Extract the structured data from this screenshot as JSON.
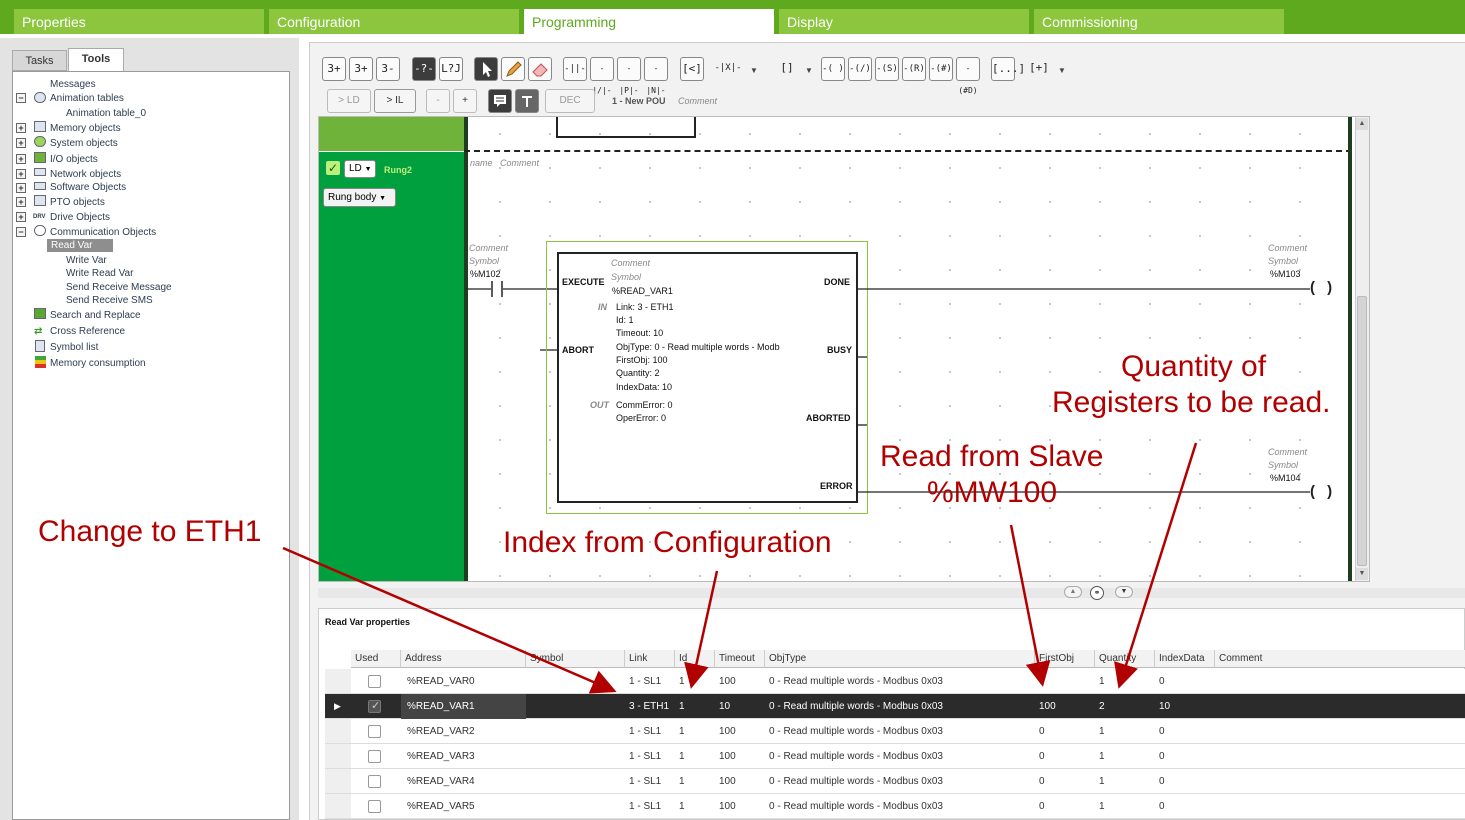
{
  "main_tabs": [
    "Properties",
    "Configuration",
    "Programming",
    "Display",
    "Commissioning"
  ],
  "active_tab": "Programming",
  "left": {
    "tabs": [
      "Tasks",
      "Tools"
    ],
    "tree": [
      {
        "label": "Messages"
      },
      {
        "label": "Animation tables",
        "icon": "magnifier-icon"
      },
      {
        "label": "Animation table_0"
      },
      {
        "label": "Memory objects",
        "icon": "memory-icon"
      },
      {
        "label": "System objects",
        "icon": "gear-icon"
      },
      {
        "label": "I/O objects",
        "icon": "io-icon"
      },
      {
        "label": "Network objects",
        "icon": "network-icon"
      },
      {
        "label": "Software Objects",
        "icon": "software-icon"
      },
      {
        "label": "PTO objects",
        "icon": "pto-icon"
      },
      {
        "label": "Drive Objects",
        "icon": "drive-icon"
      },
      {
        "label": "Communication Objects",
        "icon": "communication-icon"
      },
      {
        "label": "Read Var"
      },
      {
        "label": "Write Var"
      },
      {
        "label": "Write Read Var"
      },
      {
        "label": "Send Receive Message"
      },
      {
        "label": "Send Receive SMS"
      },
      {
        "label": "Search and Replace",
        "icon": "search-replace-icon"
      },
      {
        "label": "Cross Reference",
        "icon": "cross-reference-icon"
      },
      {
        "label": "Symbol list",
        "icon": "symbol-list-icon"
      },
      {
        "label": "Memory consumption",
        "icon": "memory-consumption-icon"
      }
    ]
  },
  "toolbar": {
    "row1": [
      "3+",
      "3+",
      "3-",
      "-?-",
      "L?J",
      "pointer",
      "pencil",
      "eraser",
      "-||-",
      "-|/|-",
      "-|P|-",
      "-|N|-",
      "[<]",
      "-|X|-",
      "[]",
      "-( )",
      "-(/)",
      "-(S)",
      "-(R)",
      "-(#)",
      "-(#D)",
      "[...]",
      "[+]"
    ],
    "ld_button": "> LD",
    "il_button": "> IL",
    "minus_button": "-",
    "plus_button": "+",
    "dec_button": "DEC",
    "pou_label": "1 - New POU",
    "comment_label": "Comment"
  },
  "rung": {
    "lang": "LD",
    "name": "Rung2",
    "body_dropdown": "Rung body",
    "header_name": "name",
    "header_comment": "Comment"
  },
  "ladder": {
    "contact": {
      "comment": "Comment",
      "symbol": "Symbol",
      "address": "%M102"
    },
    "coil_done": {
      "comment": "Comment",
      "symbol": "Symbol",
      "address": "%M103"
    },
    "coil_error": {
      "comment": "Comment",
      "symbol": "Symbol",
      "address": "%M104"
    },
    "block": {
      "comment": "Comment",
      "symbol": "Symbol",
      "name": "%READ_VAR1",
      "inputs": [
        "EXECUTE",
        "ABORT"
      ],
      "outputs": [
        "DONE",
        "BUSY",
        "ABORTED",
        "ERROR"
      ],
      "in_label": "IN",
      "out_label": "OUT",
      "params": [
        "Link: 3 - ETH1",
        "Id: 1",
        "Timeout: 10",
        "ObjType: 0 - Read multiple words - Modb",
        "FirstObj: 100",
        "Quantity: 2",
        "IndexData: 10"
      ],
      "out_params": [
        "CommError: 0",
        "OperError: 0"
      ]
    }
  },
  "annotations": {
    "quantity": "Quantity of",
    "quantity2": "Registers to be read.",
    "slave": "Read from Slave",
    "slave2": "%MW100",
    "eth": "Change to ETH1",
    "index": "Index from Configuration"
  },
  "properties": {
    "title": "Read Var properties",
    "columns": [
      "Used",
      "Address",
      "Symbol",
      "Link",
      "Id",
      "Timeout",
      "ObjType",
      "FirstObj",
      "Quantity",
      "IndexData",
      "Comment"
    ],
    "rows": [
      {
        "used": false,
        "address": "%READ_VAR0",
        "symbol": "",
        "link": "1 - SL1",
        "id": "1",
        "timeout": "100",
        "objtype": "0 - Read multiple words - Modbus 0x03",
        "firstobj": "0",
        "quantity": "1",
        "indexdata": "0",
        "comment": ""
      },
      {
        "used": true,
        "address": "%READ_VAR1",
        "symbol": "",
        "link": "3 - ETH1",
        "id": "1",
        "timeout": "10",
        "objtype": "0 - Read multiple words - Modbus 0x03",
        "firstobj": "100",
        "quantity": "2",
        "indexdata": "10",
        "comment": ""
      },
      {
        "used": false,
        "address": "%READ_VAR2",
        "symbol": "",
        "link": "1 - SL1",
        "id": "1",
        "timeout": "100",
        "objtype": "0 - Read multiple words - Modbus 0x03",
        "firstobj": "0",
        "quantity": "1",
        "indexdata": "0",
        "comment": ""
      },
      {
        "used": false,
        "address": "%READ_VAR3",
        "symbol": "",
        "link": "1 - SL1",
        "id": "1",
        "timeout": "100",
        "objtype": "0 - Read multiple words - Modbus 0x03",
        "firstobj": "0",
        "quantity": "1",
        "indexdata": "0",
        "comment": ""
      },
      {
        "used": false,
        "address": "%READ_VAR4",
        "symbol": "",
        "link": "1 - SL1",
        "id": "1",
        "timeout": "100",
        "objtype": "0 - Read multiple words - Modbus 0x03",
        "firstobj": "0",
        "quantity": "1",
        "indexdata": "0",
        "comment": ""
      },
      {
        "used": false,
        "address": "%READ_VAR5",
        "symbol": "",
        "link": "1 - SL1",
        "id": "1",
        "timeout": "100",
        "objtype": "0 - Read multiple words - Modbus 0x03",
        "firstobj": "0",
        "quantity": "1",
        "indexdata": "0",
        "comment": ""
      }
    ]
  }
}
